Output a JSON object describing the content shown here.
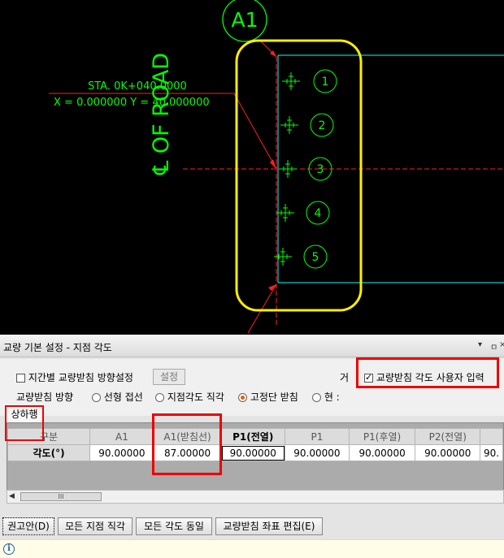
{
  "cad": {
    "a1_label": "A1",
    "sta_label": "STA. 0K+040.0000",
    "xy_label": "X = 0.000000  Y = 40.000000",
    "road_label": "℄ OF ROAD",
    "bearing_markers": [
      "1",
      "2",
      "3",
      "4",
      "5"
    ],
    "colors": {
      "green": "#00ff00",
      "cyan": "#00ffff",
      "red": "#ff2020",
      "yellow": "#ffee00"
    }
  },
  "panel": {
    "title": "교량 기본 설정 - 지점 각도",
    "title_controls": [
      "▾",
      "ㅁ",
      "×"
    ],
    "span_direction": {
      "label": "지간별 교량받침 방향설정",
      "checked": false
    },
    "settings_button": "설정",
    "truncated_label": "거",
    "user_input": {
      "label": "교량받침 각도 사용자 입력",
      "checked": true
    },
    "direction_label": "교량받침 방향",
    "radio_options": [
      {
        "label": "선형 접선",
        "selected": false
      },
      {
        "label": "지점각도 직각",
        "selected": false
      },
      {
        "label": "고정단 받침",
        "selected": true
      },
      {
        "label": "현 :",
        "selected": false
      }
    ],
    "tab": "상하행",
    "grid": {
      "headers": [
        "구분",
        "A1",
        "A1(받침선)",
        "P1(전열)",
        "P1",
        "P1(후열)",
        "P2(전열)",
        ""
      ],
      "row_label": "각도(°)",
      "values": [
        "90.00000",
        "87.00000",
        "90.00000",
        "90.00000",
        "90.00000",
        "90.00000",
        "90."
      ]
    },
    "scrollbar_thumb": "III",
    "buttons": [
      "권고안(D)",
      "모든 지점 직각",
      "모든 각도 동일",
      "교량받침 좌표 편집(E)"
    ],
    "status_icon": "info-icon"
  }
}
